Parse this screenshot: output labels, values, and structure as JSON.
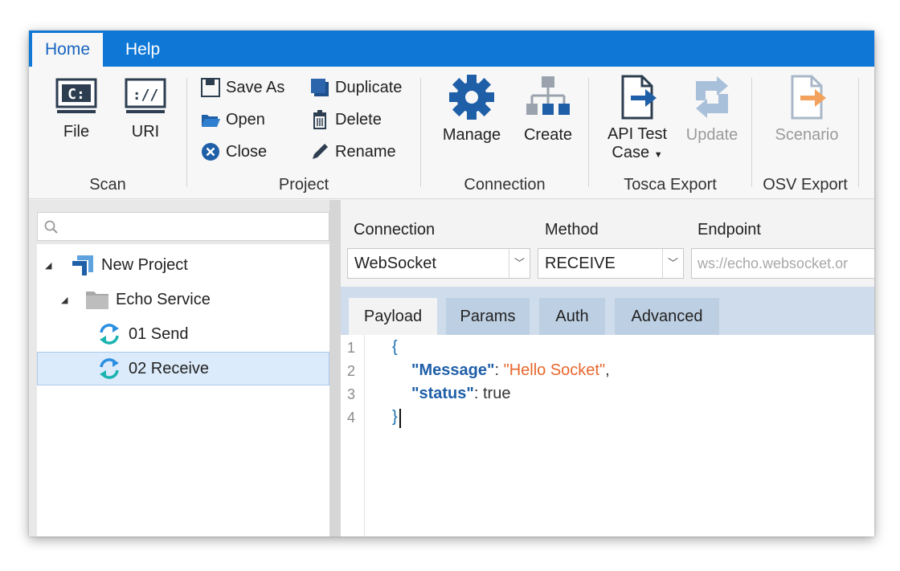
{
  "ribbon_tabs": [
    {
      "label": "Home",
      "active": true
    },
    {
      "label": "Help",
      "active": false
    }
  ],
  "groups": {
    "scan": {
      "label": "Scan",
      "file": {
        "label": "File",
        "icon": "drive-c-icon"
      },
      "uri": {
        "label": "URI",
        "icon": "uri-slashes-icon"
      }
    },
    "project": {
      "label": "Project",
      "save_as": "Save As",
      "open": "Open",
      "close": "Close",
      "duplicate": "Duplicate",
      "delete": "Delete",
      "rename": "Rename"
    },
    "connection": {
      "label": "Connection",
      "manage": "Manage",
      "create": "Create"
    },
    "tosca_export": {
      "label": "Tosca Export",
      "api_test_case_line1": "API Test",
      "api_test_case_line2": "Case",
      "update": "Update"
    },
    "osv_export": {
      "label": "OSV Export",
      "scenario": "Scenario"
    }
  },
  "tree": {
    "search_placeholder": "",
    "nodes": [
      {
        "label": "New Project",
        "icon": "project-icon",
        "level": 0
      },
      {
        "label": "Echo Service",
        "icon": "folder-icon",
        "level": 1
      },
      {
        "label": "01 Send",
        "icon": "sync-icon",
        "level": 2
      },
      {
        "label": "02 Receive",
        "icon": "sync-icon",
        "level": 2,
        "selected": true
      }
    ]
  },
  "request": {
    "connection_label": "Connection",
    "connection_value": "WebSocket",
    "method_label": "Method",
    "method_value": "RECEIVE",
    "endpoint_label": "Endpoint",
    "endpoint_value": "ws://echo.websocket.or"
  },
  "payload_tabs": [
    {
      "label": "Payload",
      "active": true
    },
    {
      "label": "Params",
      "active": false
    },
    {
      "label": "Auth",
      "active": false
    },
    {
      "label": "Advanced",
      "active": false
    }
  ],
  "editor": {
    "line_numbers": [
      "1",
      "2",
      "3",
      "4"
    ],
    "open_brace": "{",
    "key_message": "\"Message\"",
    "colon1": ": ",
    "value_message": "\"Hello Socket\"",
    "comma": ",",
    "key_status": "\"status\"",
    "colon2": ": ",
    "value_status": "true",
    "close_brace": "}"
  },
  "colors": {
    "accent": "#0f78d7",
    "json_key": "#1f5fa8",
    "json_string": "#e8662b"
  }
}
